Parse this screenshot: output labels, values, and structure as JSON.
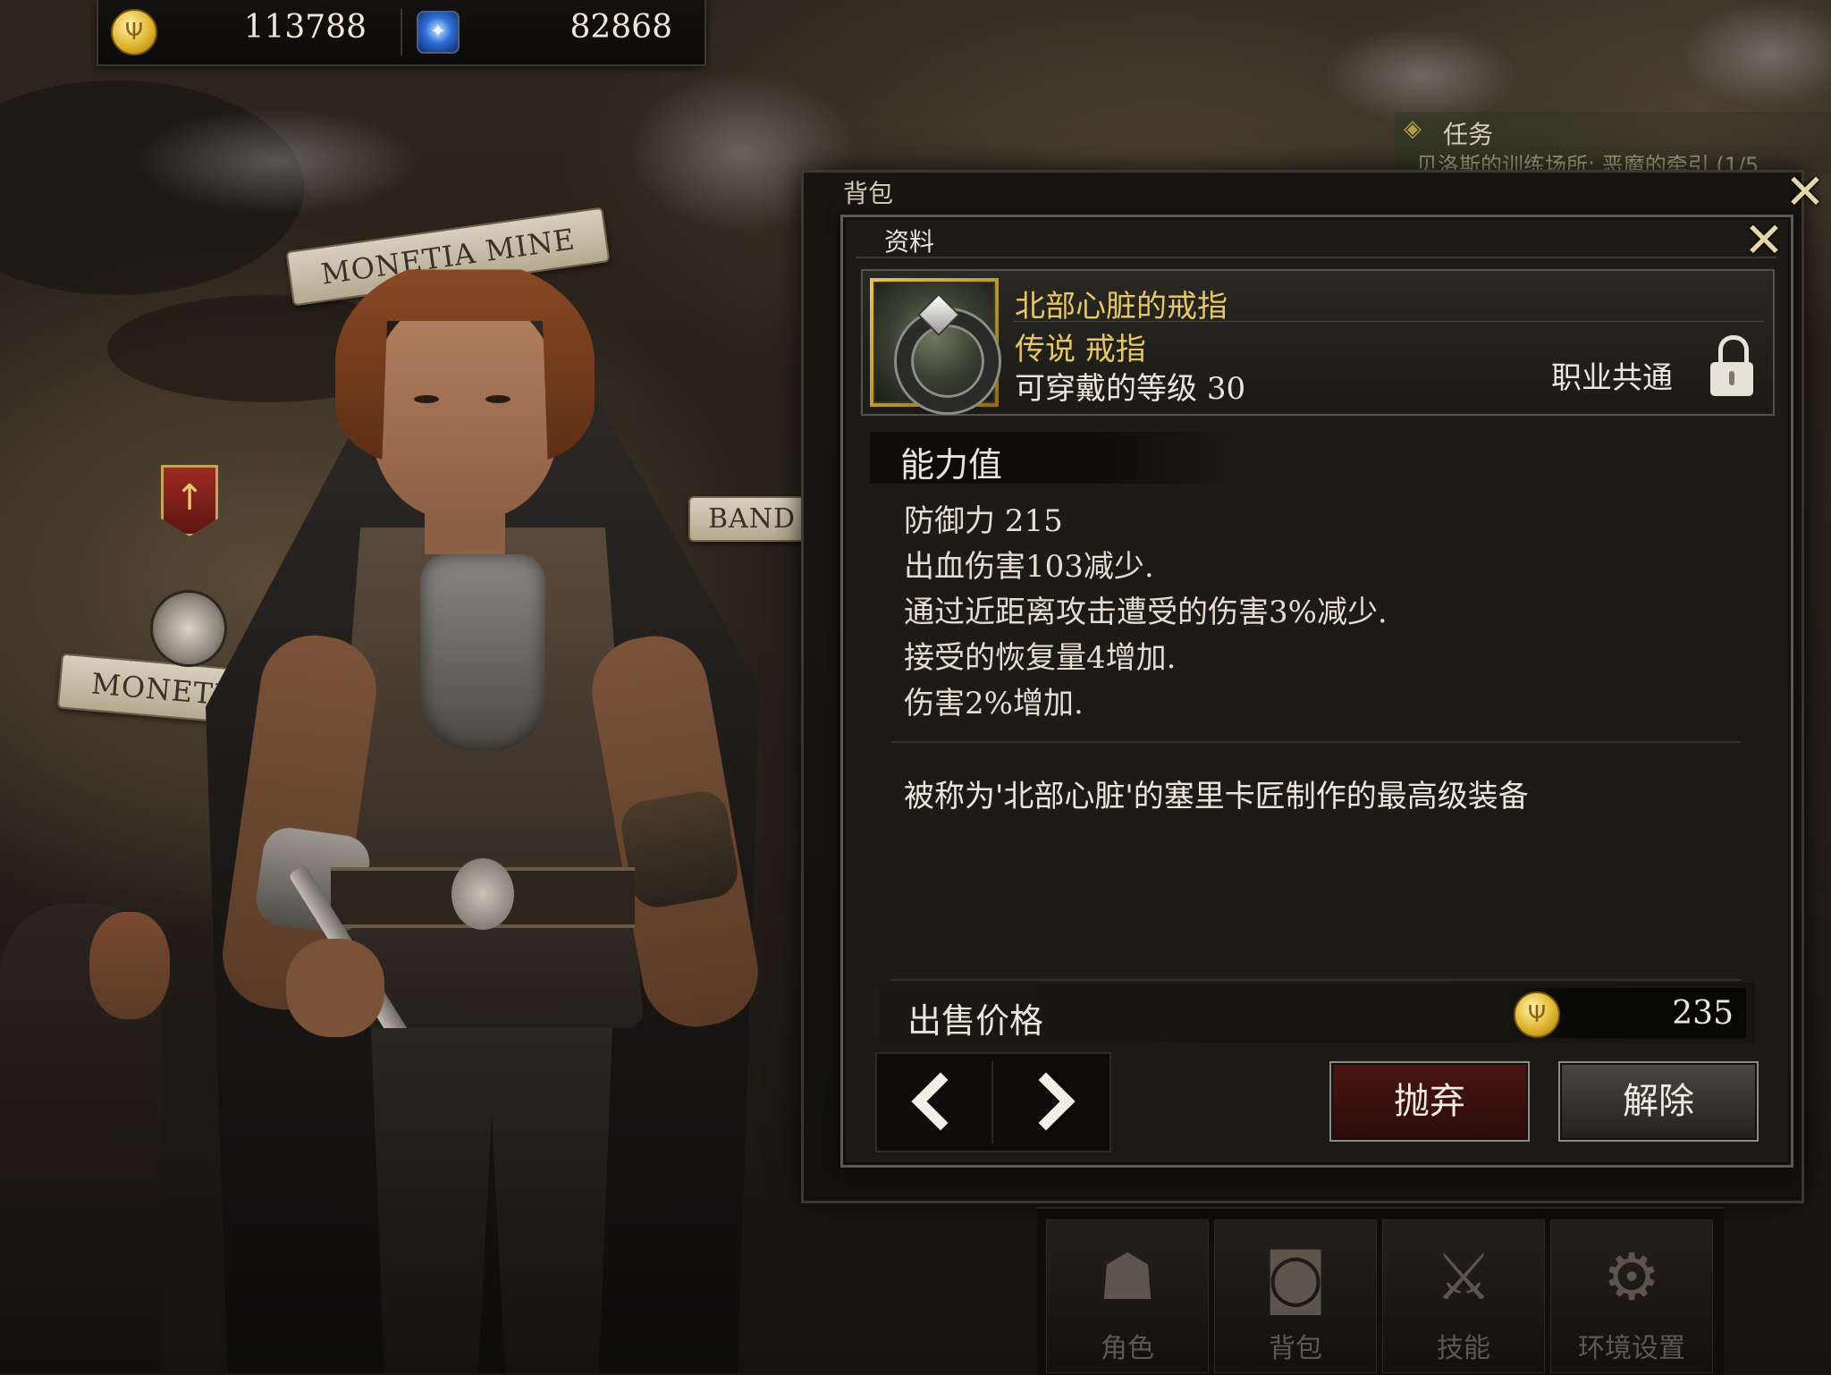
{
  "currency": {
    "gold": "113788",
    "gems": "82868",
    "gold_icon": "gold-coin-icon",
    "gem_icon": "blue-gem-icon"
  },
  "map": {
    "labels": [
      "MONETIA MINE",
      "MONETI",
      "BAND"
    ]
  },
  "quest": {
    "title": "任务",
    "text": "贝洛斯的训练场所: 恶魔的牵引 (1/5"
  },
  "inventory": {
    "title": "背包",
    "close_icon": "close-x-icon"
  },
  "info": {
    "title": "资料",
    "close_icon": "close-x-icon",
    "item": {
      "name": "北部心脏的戒指",
      "rarity": "传说 戒指",
      "level_label": "可穿戴的等级",
      "level_value": "30",
      "class": "职业共通",
      "icon": "ring-icon",
      "lock_icon": "lock-icon"
    },
    "stats_heading": "能力值",
    "stats": [
      "防御力 215",
      "出血伤害103减少.",
      "通过近距离攻击遭受的伤害3%减少.",
      "接受的恢复量4增加.",
      "伤害2%增加."
    ],
    "description": "被称为'北部心脏'的塞里卡匠制作的最高级装备",
    "price_label": "出售价格",
    "price_value": "235",
    "buttons": {
      "discard": "抛弃",
      "unequip": "解除"
    }
  },
  "bottom_nav": [
    {
      "label": "角色",
      "icon": "hooded-figure-icon"
    },
    {
      "label": "背包",
      "icon": "backpack-icon"
    },
    {
      "label": "技能",
      "icon": "crossed-swords-icon"
    },
    {
      "label": "环境设置",
      "icon": "gear-icon"
    }
  ],
  "colors": {
    "gold_text": "#e4c768",
    "discard_bg": "#4a1612",
    "panel_bg": "#1d1b17"
  }
}
